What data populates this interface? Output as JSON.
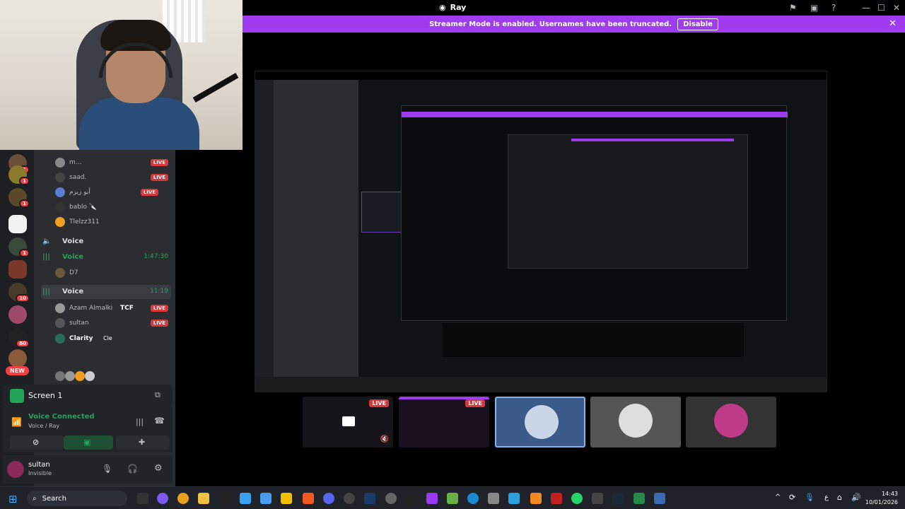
{
  "window": {
    "title": "Ray"
  },
  "banner": {
    "text": "Streamer Mode is enabled. Usernames have been truncated.",
    "button": "Disable"
  },
  "channels": {
    "members_top": [
      {
        "name": "m...",
        "live": "LIVE"
      },
      {
        "name": "saad.",
        "live": "LIVE"
      },
      {
        "name": "أبو زيزم",
        "live": "LIVE"
      },
      {
        "name": "bablo 🔪",
        "live": ""
      },
      {
        "name": "Tlelzz311",
        "live": ""
      }
    ],
    "voice1": {
      "name": "Voice",
      "time": ""
    },
    "voice2": {
      "name": "Voice",
      "time": "1:47:30"
    },
    "voice2_members": [
      {
        "name": "D7"
      }
    ],
    "voice3": {
      "name": "Voice",
      "time": "11:19"
    },
    "voice3_members": [
      {
        "name": "Azam Almalki",
        "tag": "TCF",
        "live": "LIVE"
      },
      {
        "name": "sultan",
        "live": "LIVE"
      },
      {
        "name": "Clarity",
        "tag": "Cle"
      }
    ]
  },
  "rail": {
    "new_label": "NEW",
    "badges": [
      "1",
      "1",
      "1",
      "1",
      "10",
      "80"
    ]
  },
  "screen_card": {
    "title": "Screen 1"
  },
  "voice_card": {
    "status": "Voice Connected",
    "sub": "Voice / Ray"
  },
  "user": {
    "name": "sultan",
    "status": "Invisible"
  },
  "thumbs": {
    "live_label": "LIVE"
  },
  "taskbar": {
    "search": "Search",
    "time": "14:43",
    "date": "10/01/2026",
    "lang": "ع"
  },
  "colors": {
    "accent": "#a03cf0",
    "live": "#da373c",
    "voice": "#23a559",
    "bg": "#2b2d31"
  }
}
